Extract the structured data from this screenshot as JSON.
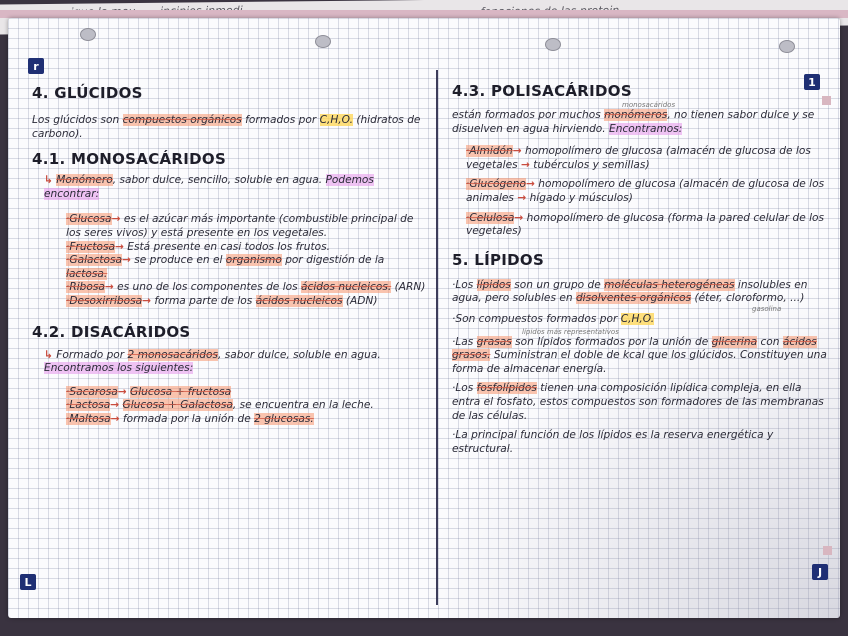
{
  "top_fragments": [
    "...igue la mou... ...incipios inmedi...",
    "...fonaciones de las protein..."
  ],
  "corner_labels": {
    "top_left": "r",
    "top_right": "1",
    "bottom_left": "L",
    "bottom_right": "J"
  },
  "left": {
    "h1": "4. GLÚCIDOS",
    "glucidos_text_a": "Los glúcidos son ",
    "glucidos_hl": "compuestos orgánicos",
    "glucidos_text_b": " formados por ",
    "glucidos_chon": "C,H,O.",
    "glucidos_text_c": "(hidratos de carbono).",
    "h2": "4.1. MONOSACÁRIDOS",
    "mono_hl": "Monómero",
    "mono_text": ", sabor dulce, sencillo, soluble en agua. ",
    "mono_hl2": "Podemos encontrar:",
    "glucosa_name": "·Glucosa",
    "glucosa_text": " es el azúcar más importante (combustible principal de los seres vivos) y está presente en los vegetales.",
    "fructosa_name": "·Fructosa",
    "fructosa_text": " Está presente en casi todos los frutos.",
    "galactosa_name": "·Galactosa",
    "galactosa_text_a": " se produce en el ",
    "galactosa_hl": "organismo",
    "galactosa_text_b": " por digestión de la ",
    "galactosa_hl2": "lactosa.",
    "ribosa_name": "·Ribosa",
    "ribosa_text_a": " es uno de los componentes de los ",
    "ribosa_hl": "ácidos nucleicos.",
    "ribosa_text_b": " (ARN)",
    "desox_name": "·Desoxirribosa",
    "desox_text_a": " forma parte de los ",
    "desox_hl": "ácidos nucleicos",
    "desox_text_b": " (ADN)",
    "h3": "4.2. DISACÁRIDOS",
    "di_text_a": "Formado por ",
    "di_hl": "2 monosacáridos",
    "di_text_b": ", sabor dulce, soluble en agua. ",
    "di_hl2": "Encontramos los siguientes:",
    "sacarosa_name": "·Sacarosa",
    "sacarosa_text": "Glucosa + fructosa",
    "lactosa_name": "·Lactosa",
    "lactosa_text": "Glucosa + Galactosa",
    "lactosa_text_b": ", se encuentra en la leche.",
    "maltosa_name": "·Maltosa",
    "maltosa_text_a": " formada por la unión de ",
    "maltosa_hl": "2 glucosas."
  },
  "right": {
    "h1": "4.3. POLISACÁRIDOS",
    "poly_sup": "monosacáridos",
    "poly_text_a": "están formados por muchos ",
    "poly_hl": "monómeros",
    "poly_text_b": ", no tienen sabor dulce y se disuelven en agua hirviendo. ",
    "poly_hl2": "Encontramos:",
    "almidon_name": "·Almidón",
    "almidon_text": " homopolímero de glucosa (almacén de glucosa de los vegetales ",
    "almidon_text_b": " tubérculos y semillas)",
    "glucogeno_name": "·Glucógeno",
    "glucogeno_text": " homopolímero de glucosa (almacén de glucosa de los animales ",
    "glucogeno_text_b": " hígado y músculos)",
    "celulosa_name": "·Celulosa",
    "celulosa_text": " homopolímero de glucosa (forma la pared celular de los vegetales)",
    "h2": "5. LÍPIDOS",
    "lip1_a": "·Los ",
    "lip1_hl": "lípidos",
    "lip1_b": " son un grupo de ",
    "lip1_hl2": "moléculas heterogéneas",
    "lip1_c": " insolubles en agua, pero solubles en ",
    "lip1_hl3": "disolventes orgánicos",
    "lip1_d": " (éter, cloroformo, ...)",
    "lip1_note": "gasolina",
    "lip2_a": "·Son compuestos formados por ",
    "lip2_chon": "C,H,O.",
    "lip3_sup": "lípidos más representativos",
    "lip3_a": "·Las ",
    "lip3_hl": "grasas",
    "lip3_b": " son lípidos formados por la unión de ",
    "lip3_hl2": "glicerina",
    "lip3_c": " con ",
    "lip3_hl3": "ácidos grasos.",
    "lip3_d": " Suministran el doble de kcal que los glúcidos. Constituyen una forma de almacenar energía.",
    "lip4_a": "·Los ",
    "lip4_hl": "fosfolípidos",
    "lip4_b": " tienen una composición lipídica compleja, en ella entra el fosfato, estos compuestos son formadores de las membranas de las células.",
    "lip5": "·La principal función de los lípidos es la reserva energética y estructural."
  }
}
